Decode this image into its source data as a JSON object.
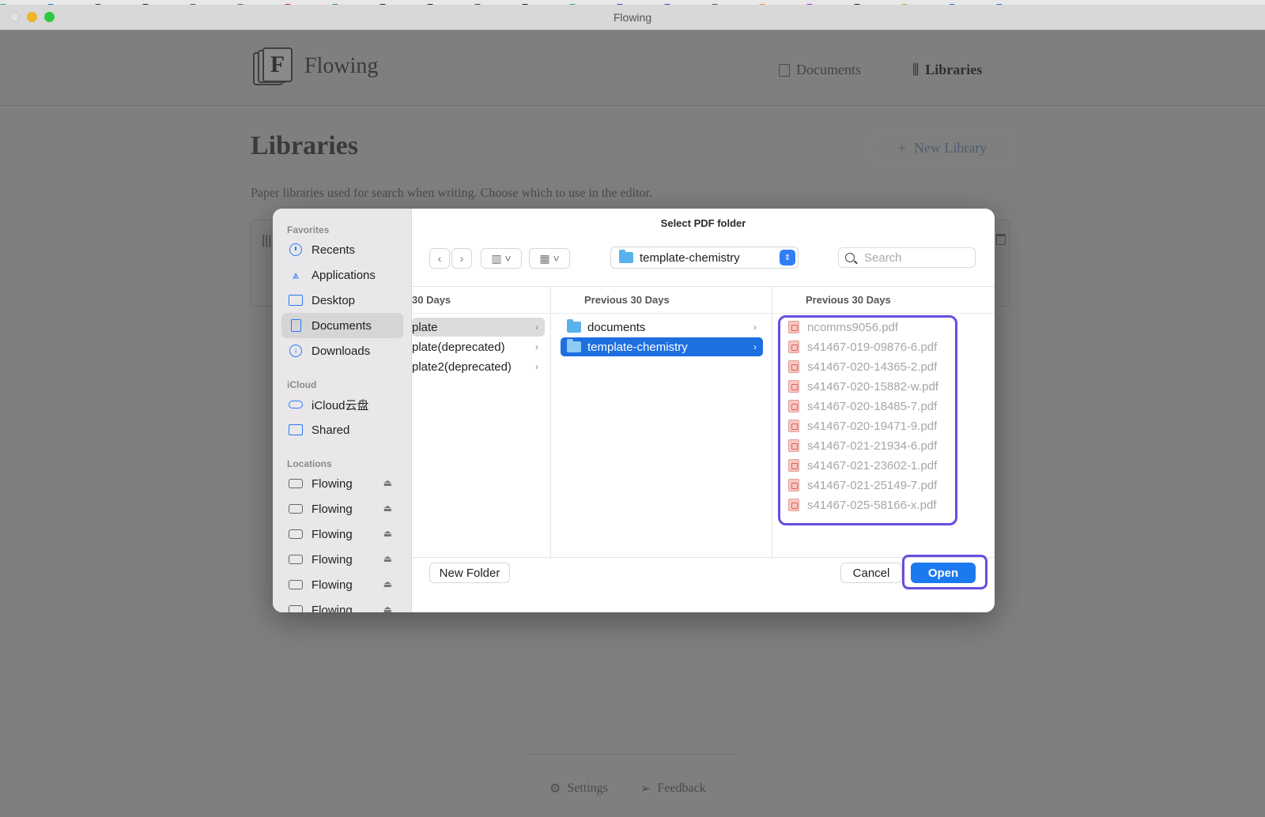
{
  "window": {
    "title": "Flowing"
  },
  "app": {
    "name": "Flowing",
    "logo_letter": "F",
    "nav": {
      "documents": "Documents",
      "libraries": "Libraries"
    },
    "page_title": "Libraries",
    "new_library_label": "New Library",
    "new_library_icon": "+",
    "subtitle": "Paper libraries used for search when writing. Choose which to use in the editor.",
    "footer": {
      "settings": "Settings",
      "feedback": "Feedback"
    }
  },
  "dialog": {
    "title": "Select PDF folder",
    "current_folder": "template-chemistry",
    "search_placeholder": "Search",
    "sidebar": {
      "favorites_label": "Favorites",
      "favorites": [
        "Recents",
        "Applications",
        "Desktop",
        "Documents",
        "Downloads"
      ],
      "icloud_label": "iCloud",
      "icloud": [
        "iCloud云盘",
        "Shared"
      ],
      "locations_label": "Locations",
      "locations": [
        "Flowing",
        "Flowing",
        "Flowing",
        "Flowing",
        "Flowing",
        "Flowing"
      ]
    },
    "columns": [
      {
        "header": "30 Days",
        "items": [
          "plate",
          "plate(deprecated)",
          "plate2(deprecated)"
        ]
      },
      {
        "header": "Previous 30 Days",
        "items": [
          "documents",
          "template-chemistry"
        ]
      },
      {
        "header": "Previous 30 Days",
        "items": [
          "ncomms9056.pdf",
          "s41467-019-09876-6.pdf",
          "s41467-020-14365-2.pdf",
          "s41467-020-15882-w.pdf",
          "s41467-020-18485-7.pdf",
          "s41467-020-19471-9.pdf",
          "s41467-021-21934-6.pdf",
          "s41467-021-23602-1.pdf",
          "s41467-021-25149-7.pdf",
          "s41467-025-58166-x.pdf"
        ]
      }
    ],
    "buttons": {
      "new_folder": "New Folder",
      "cancel": "Cancel",
      "open": "Open"
    },
    "colors": {
      "accent": "#1c7af0",
      "highlight": "#6a4ce0",
      "selection": "#1e6fe0"
    }
  }
}
